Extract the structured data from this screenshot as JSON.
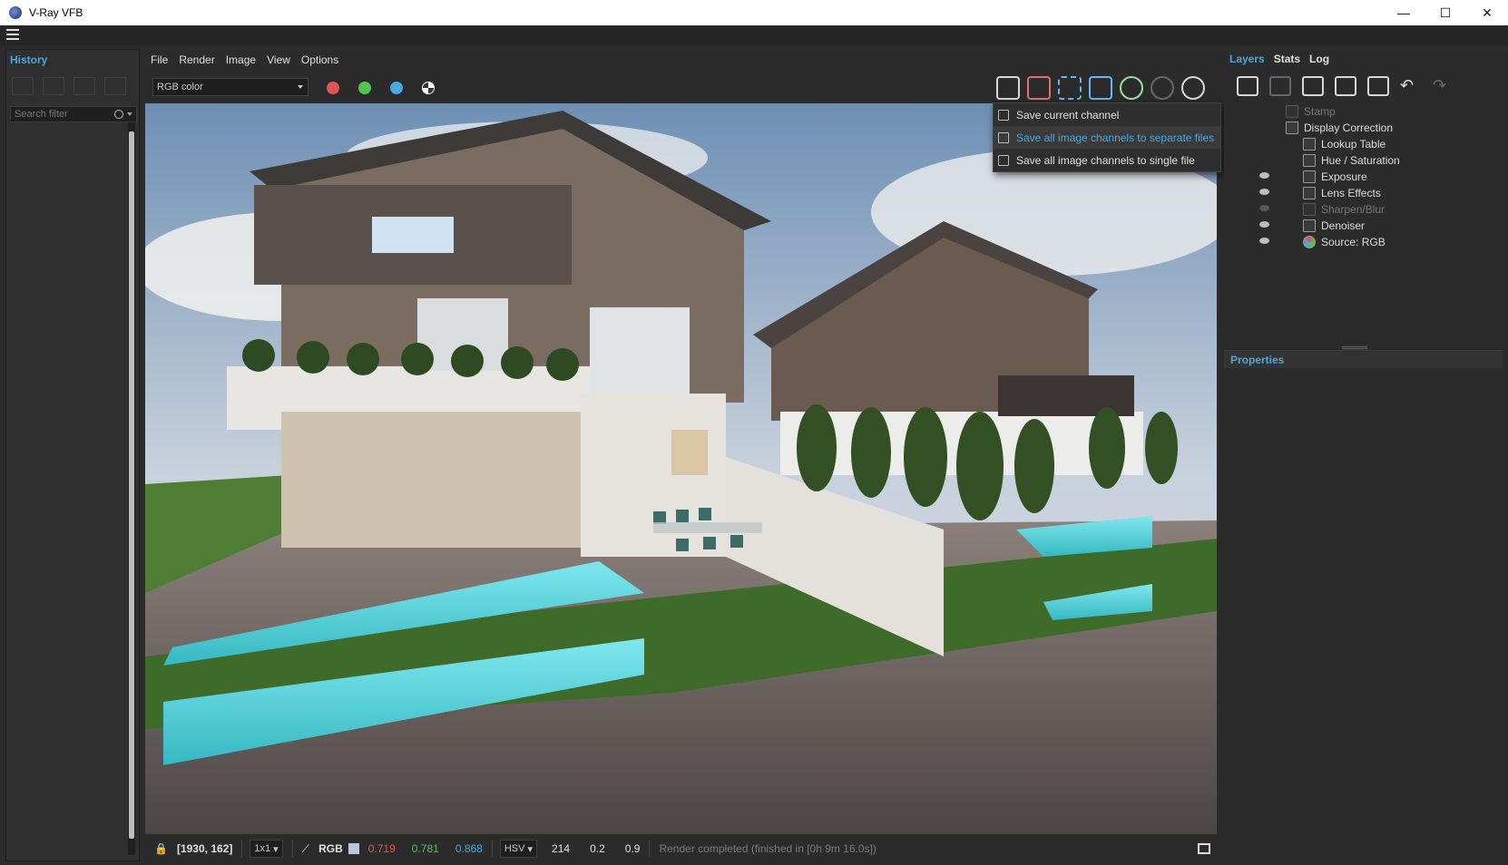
{
  "window": {
    "title": "V-Ray VFB",
    "minimize": "—",
    "maximize": "☐",
    "close": "✕"
  },
  "menu": [
    "File",
    "Render",
    "Image",
    "View",
    "Options"
  ],
  "history": {
    "tab": "History",
    "search_placeholder": "Search filter"
  },
  "channel": {
    "selected": "RGB color"
  },
  "save_menu": {
    "items": [
      "Save current channel",
      "Save all image channels to separate files",
      "Save all image channels to single file"
    ],
    "highlighted_index": 1
  },
  "right_tabs": [
    "Layers",
    "Stats",
    "Log"
  ],
  "layers": [
    {
      "name": "Stamp",
      "visible": false,
      "dim": true
    },
    {
      "name": "Display Correction",
      "visible": false,
      "dim": false
    },
    {
      "name": "Lookup Table",
      "visible": false,
      "dim": false
    },
    {
      "name": "Hue / Saturation",
      "visible": false,
      "dim": false
    },
    {
      "name": "Exposure",
      "visible": true,
      "dim": false
    },
    {
      "name": "Lens Effects",
      "visible": true,
      "dim": false
    },
    {
      "name": "Sharpen/Blur",
      "visible": false,
      "dim": true
    },
    {
      "name": "Denoiser",
      "visible": true,
      "dim": false
    },
    {
      "name": "Source: RGB",
      "visible": true,
      "dim": false
    }
  ],
  "properties": {
    "title": "Properties"
  },
  "status": {
    "coords": "[1930, 162]",
    "zoom": "1x1",
    "mode": "RGB",
    "r": "0.719",
    "g": "0.781",
    "b": "0.868",
    "color_space": "HSV",
    "h": "214",
    "s": "0.2",
    "v": "0.9",
    "message": "Render completed (finished in [0h  9m 16.0s])"
  },
  "colors": {
    "accent": "#4aa8e0",
    "red": "#e05555",
    "green": "#52c452",
    "blue": "#4aa8e0"
  }
}
